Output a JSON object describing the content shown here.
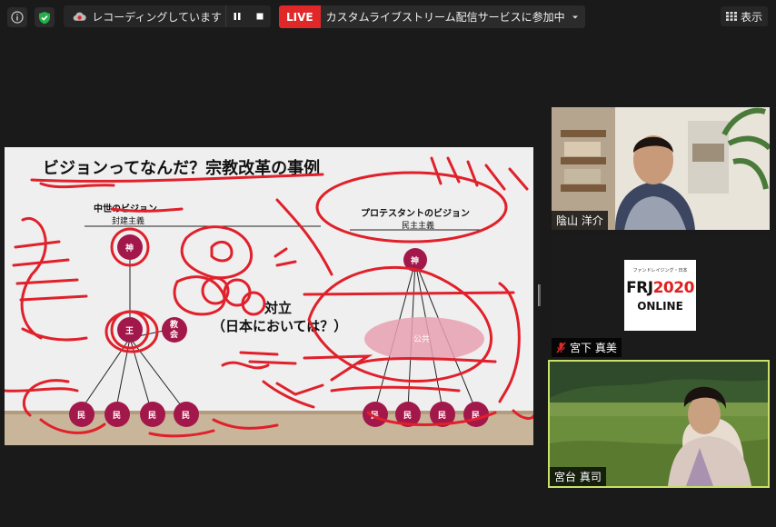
{
  "recording": {
    "label": "レコーディングしています..."
  },
  "live": {
    "badge": "LIVE",
    "text": "カスタムライブストリーム配信サービスに参加中"
  },
  "view_label": "表示",
  "slide": {
    "title": "ビジョンってなんだ？宗教改革の事例",
    "left_heading": "中世のビジョン",
    "left_sub": "封建主義",
    "right_heading": "プロテスタントのビジョン",
    "right_sub": "民主主義",
    "center_1": "対立",
    "center_2": "（日本においては？）",
    "god": "神",
    "king": "王",
    "church_1": "教",
    "church_2": "会",
    "public": "公共",
    "people": "民"
  },
  "participants": [
    {
      "name": "陰山 洋介"
    },
    {
      "name": "宮下 真美"
    },
    {
      "name": "宮台 真司"
    }
  ],
  "frj": {
    "small": "ファンドレイジング・日本",
    "brand": "FRJ",
    "year": "2020",
    "online": "ONLINE"
  },
  "colors": {
    "live": "#e02828",
    "active_speaker": "#c9e069",
    "ink": "#e0202a"
  }
}
